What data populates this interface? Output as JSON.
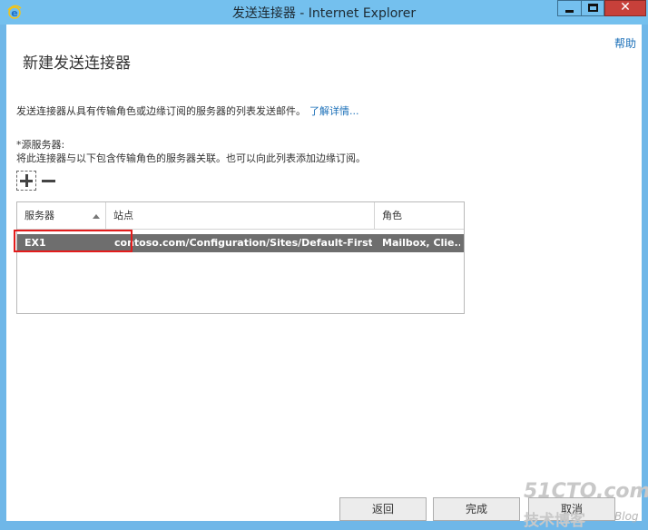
{
  "window": {
    "title": "发送连接器 - Internet Explorer",
    "close_glyph": "✕"
  },
  "page": {
    "help": "帮助",
    "title": "新建发送连接器",
    "description": "发送连接器从具有传输角色或边缘订阅的服务器的列表发送邮件。",
    "learn_more": "了解详情...",
    "source_label": "*源服务器:",
    "source_desc": "将此连接器与以下包含传输角色的服务器关联。也可以向此列表添加边缘订阅。"
  },
  "grid": {
    "columns": [
      "服务器",
      "站点",
      "角色"
    ],
    "rows": [
      [
        "EX1",
        "contoso.com/Configuration/Sites/Default-First-Si...",
        "Mailbox, Clie..."
      ]
    ]
  },
  "buttons": {
    "back": "返回",
    "finish": "完成",
    "cancel": "取消"
  },
  "watermark": {
    "main": "51CTO.com",
    "sub": "技术博客",
    "blog": "Blog"
  }
}
